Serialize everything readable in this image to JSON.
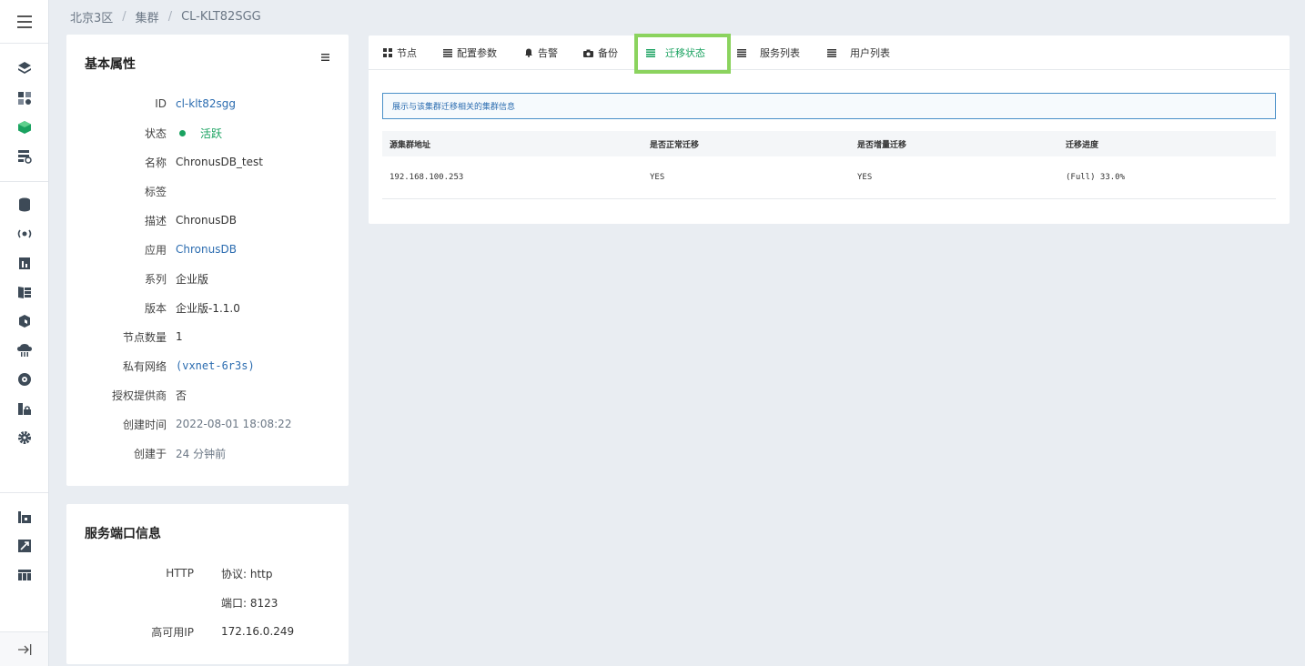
{
  "breadcrumb": [
    "北京3区",
    "集群",
    "CL-KLT82SGG"
  ],
  "nav": {
    "icons": [
      "layers-icon",
      "apps-icon",
      "cube-icon",
      "server-refresh-icon",
      "database-icon",
      "broadcast-icon",
      "bar-chart-icon",
      "storage-icon",
      "box-icon",
      "cloud-icon",
      "disk-icon",
      "lock-icon",
      "gear-icon"
    ],
    "bottom_icons": [
      "building-icon",
      "share-icon",
      "table-icon"
    ]
  },
  "basic": {
    "title": "基本属性",
    "rows": [
      {
        "key": "ID",
        "value": "cl-klt82sgg"
      },
      {
        "key": "状态",
        "value": "活跃"
      },
      {
        "key": "名称",
        "value": "ChronusDB_test"
      },
      {
        "key": "标签",
        "value": ""
      },
      {
        "key": "描述",
        "value": "ChronusDB"
      },
      {
        "key": "应用",
        "value": "ChronusDB"
      },
      {
        "key": "系列",
        "value": "企业版"
      },
      {
        "key": "版本",
        "value": "企业版-1.1.0"
      },
      {
        "key": "节点数量",
        "value": "1"
      },
      {
        "key": "私有网络",
        "value": "(vxnet-6r3s)"
      },
      {
        "key": "授权提供商",
        "value": "否"
      },
      {
        "key": "创建时间",
        "value": "2022-08-01 18:08:22"
      },
      {
        "key": "创建于",
        "value": "24 分钟前"
      }
    ]
  },
  "ports": {
    "title": "服务端口信息",
    "rows": [
      {
        "key": "HTTP",
        "value": "协议: http"
      },
      {
        "key": "",
        "value": "端口: 8123"
      },
      {
        "key": "高可用IP",
        "value": "172.16.0.249"
      }
    ]
  },
  "tabs": [
    {
      "label": "节点",
      "icon": "grid-icon"
    },
    {
      "label": "配置参数",
      "icon": "list-icon"
    },
    {
      "label": "告警",
      "icon": "bell-icon"
    },
    {
      "label": "备份",
      "icon": "camera-icon"
    },
    {
      "label": "迁移状态",
      "icon": "list-icon"
    },
    {
      "label": "服务列表",
      "icon": "list-icon"
    },
    {
      "label": "用户列表",
      "icon": "list-icon"
    }
  ],
  "active_tab": "迁移状态",
  "migration": {
    "info": "展示与该集群迁移相关的集群信息",
    "columns": [
      "源集群地址",
      "是否正常迁移",
      "是否增量迁移",
      "迁移进度"
    ],
    "rows": [
      [
        "192.168.100.253",
        "YES",
        "YES",
        "(Full) 33.0%"
      ]
    ]
  },
  "colors": {
    "accent_green": "#1aa260",
    "link_blue": "#2b6cb0",
    "highlight": "#8bd35e"
  }
}
